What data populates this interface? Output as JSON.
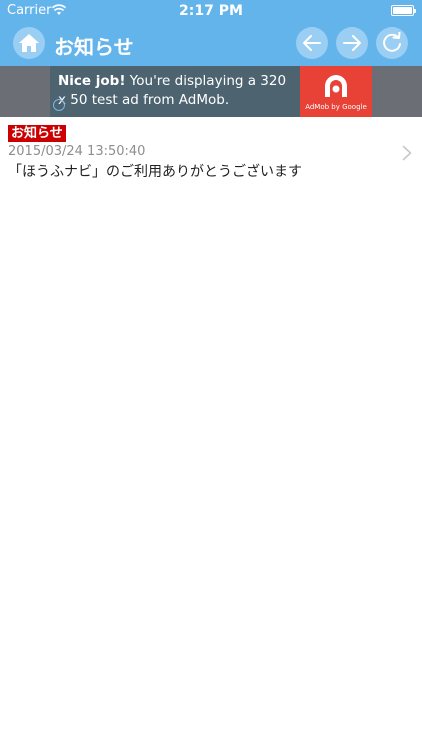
{
  "status_bar": {
    "carrier": "Carrier",
    "time": "2:17 PM"
  },
  "header": {
    "title": "お知らせ",
    "color": "#64b4ec"
  },
  "ad": {
    "headline_bold": "Nice job!",
    "headline_rest": " You're displaying a 320 x 50 test ad from AdMob.",
    "logo_text": "AdMob by Google"
  },
  "news": {
    "items": [
      {
        "badge": "お知らせ",
        "date": "2015/03/24 13:50:40",
        "text": "「ほうふナビ」のご利用ありがとうございます"
      }
    ]
  },
  "icons": {
    "home": "home-icon",
    "back": "arrow-left-icon",
    "forward": "arrow-right-icon",
    "reload": "reload-icon",
    "chevron": "chevron-right-icon"
  }
}
